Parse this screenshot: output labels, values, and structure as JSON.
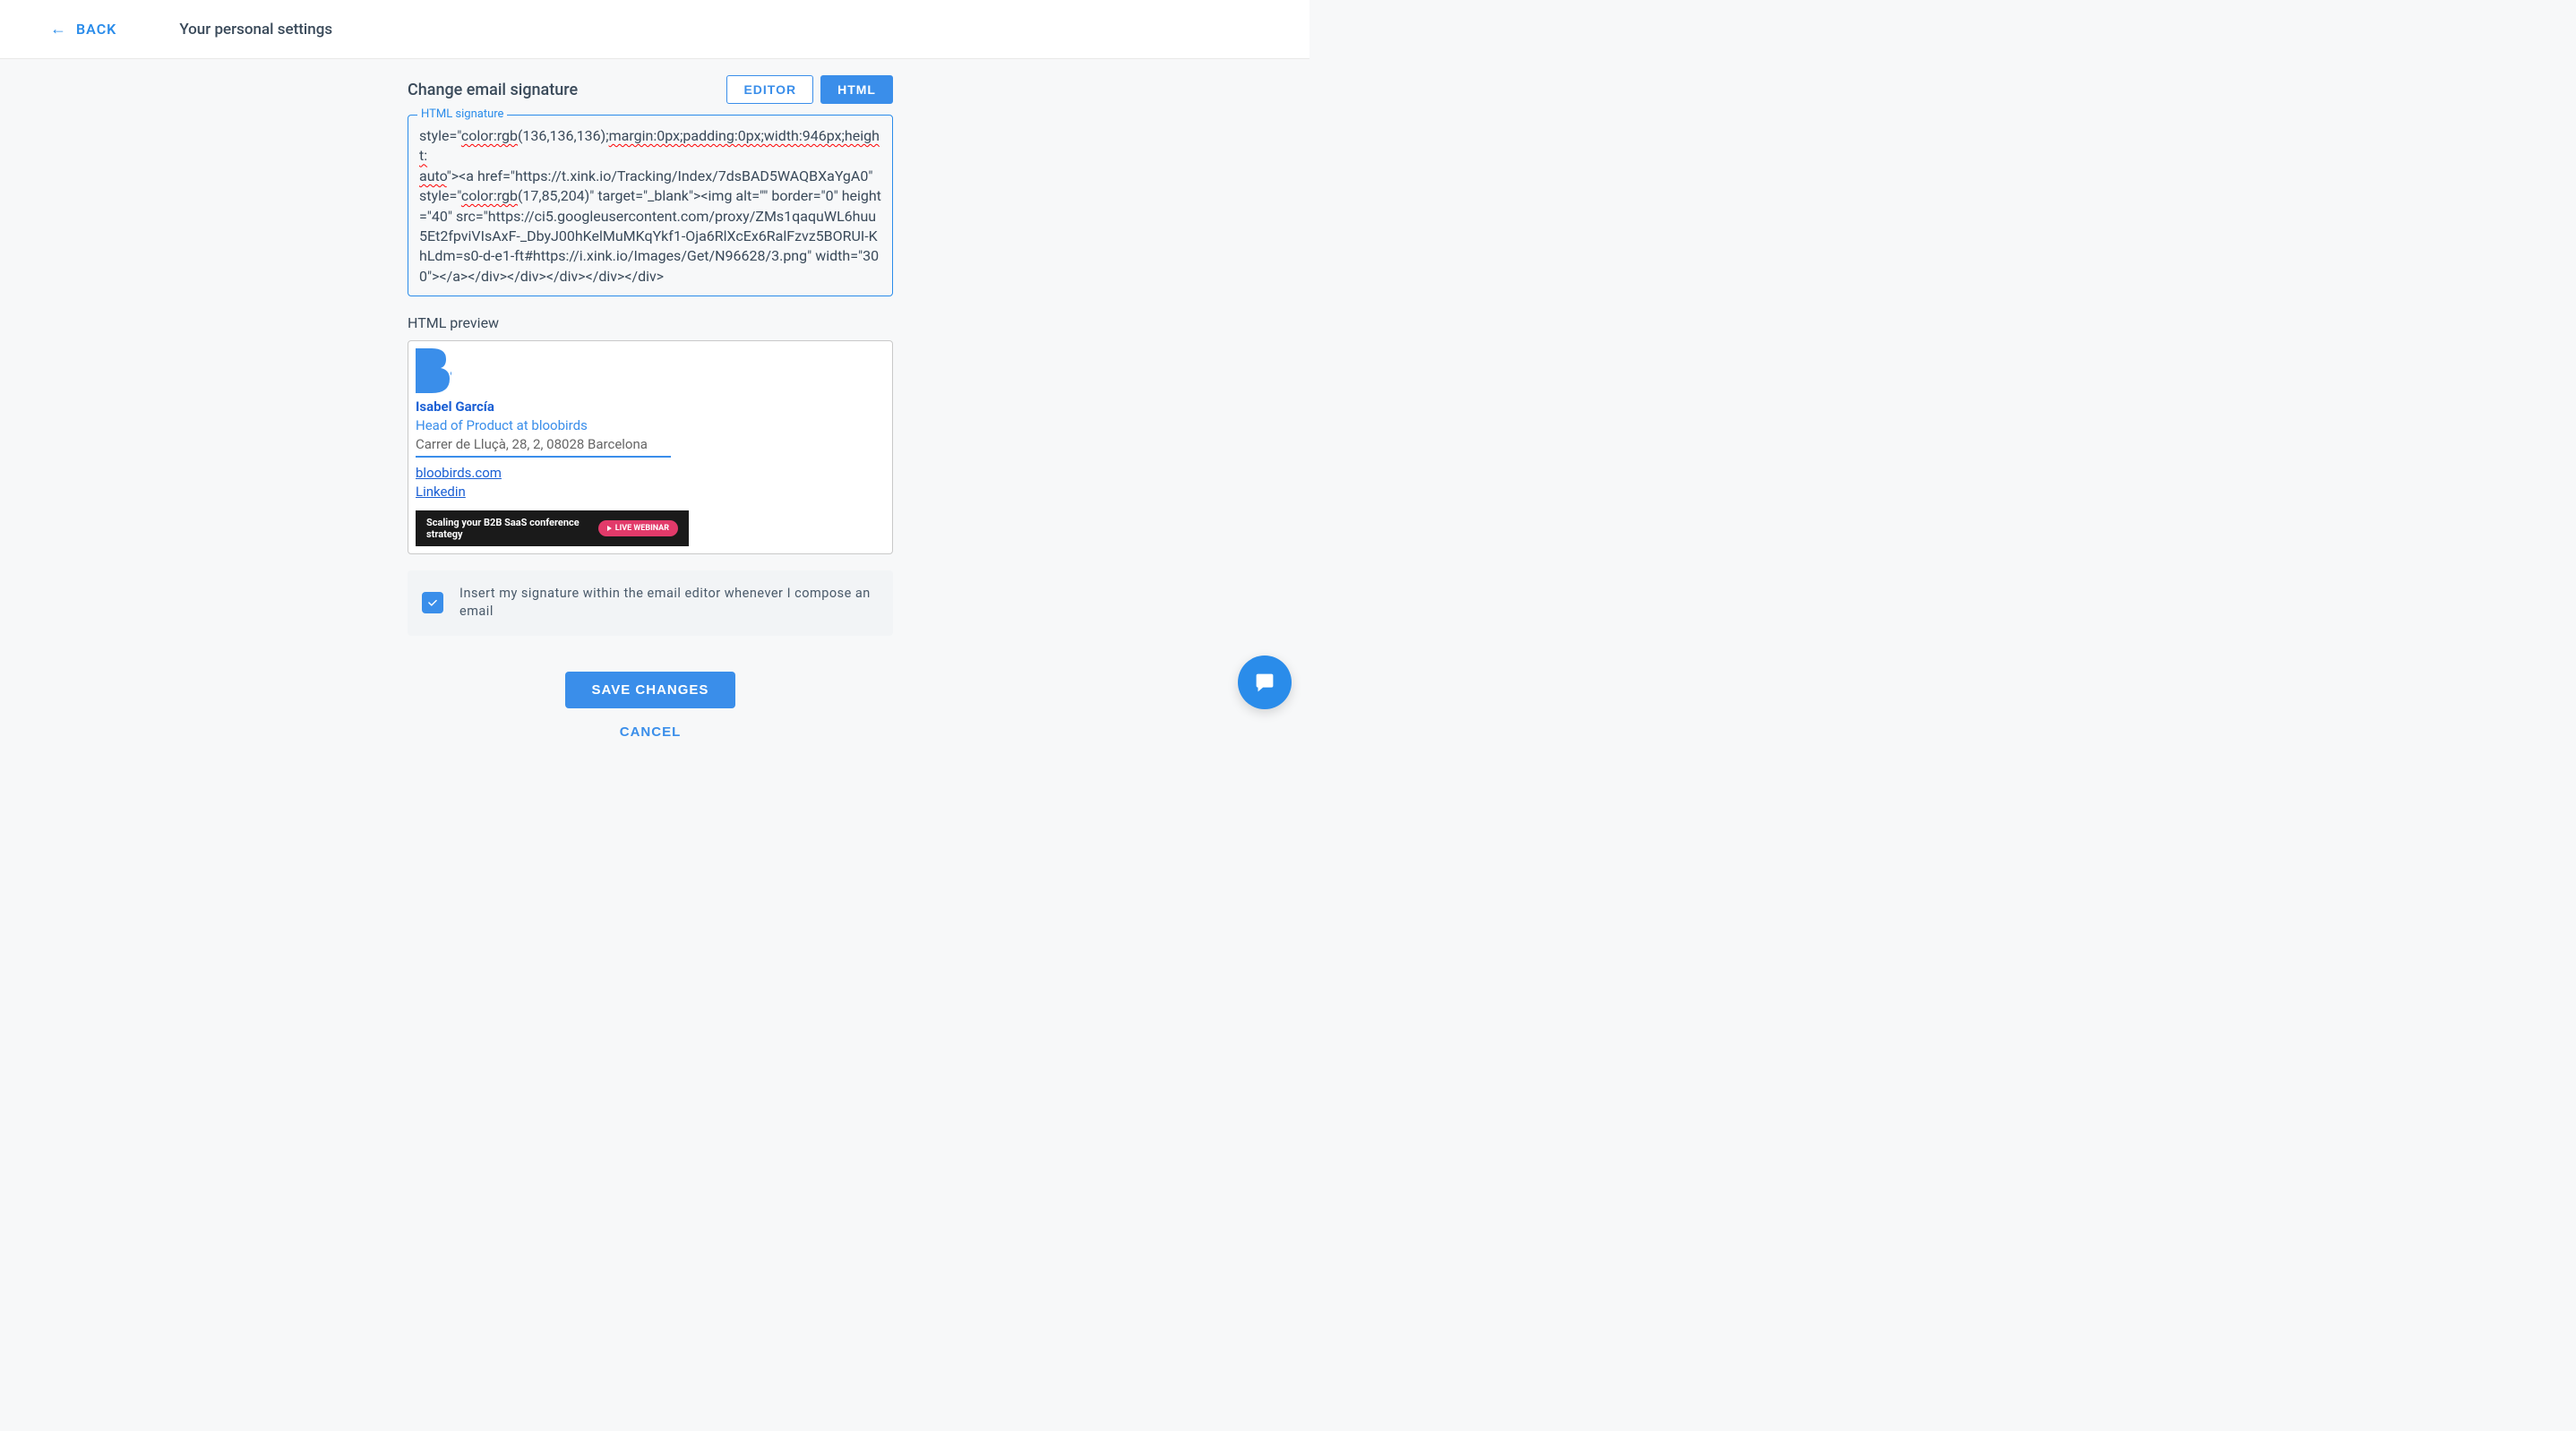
{
  "header": {
    "back_label": "BACK",
    "title": "Your personal settings"
  },
  "section": {
    "title": "Change email signature",
    "tabs": {
      "editor": "EDITOR",
      "html": "HTML"
    }
  },
  "fieldset": {
    "legend": "HTML signature",
    "content_parts": {
      "p1": "style=\"",
      "p2_err": "color:rgb",
      "p3": "(136,136,136);",
      "p4_err": "margin:0px;padding:0px;width:946px;height:",
      "p5_err": "auto",
      "p6": "\"><a href=\"https://t.xink.io/Tracking/Index/7dsBAD5WAQBXaYgA0\" style=\"",
      "p7_err": "color:rgb",
      "p8": "(17,85,204)\" target=\"_blank\"><img alt=\"\" border=\"0\" height=\"40\" src=\"https://ci5.googleusercontent.com/proxy/ZMs1qaquWL6huu5Et2fpviVIsAxF-_DbyJ00hKelMuMKqYkf1-Oja6RlXcEx6RalFzvz5BORUI-KhLdm=s0-d-e1-ft#https://i.xink.io/Images/Get/N96628/3.png\" width=\"300\"></a></div></div></div></div></div>"
    }
  },
  "preview": {
    "label": "HTML preview",
    "name": "Isabel García",
    "role": "Head of Product at bloobirds",
    "address": "Carrer de Lluçà, 28, 2, 08028 Barcelona",
    "website": "bloobirds.com",
    "linkedin": "Linkedin",
    "banner_text": "Scaling your B2B SaaS conference strategy",
    "banner_badge": "LIVE WEBINAR"
  },
  "checkbox": {
    "label": "Insert my signature within the email editor whenever I compose an email",
    "checked": true
  },
  "actions": {
    "save": "SAVE CHANGES",
    "cancel": "CANCEL"
  }
}
